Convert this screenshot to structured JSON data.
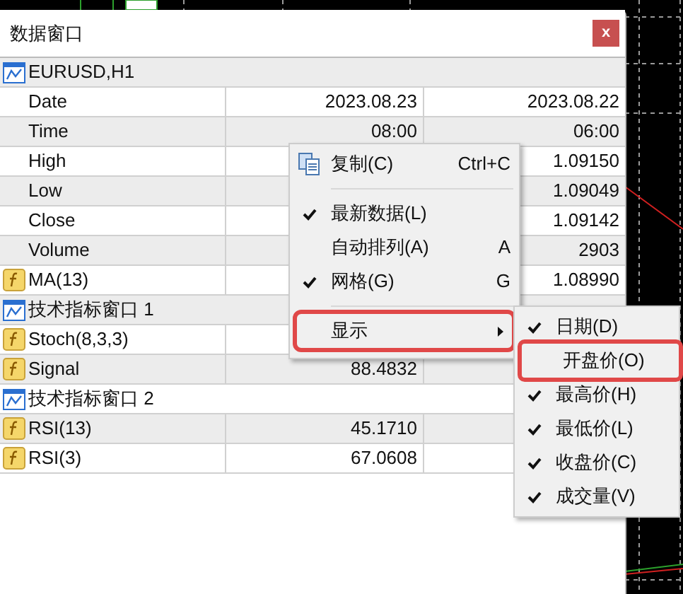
{
  "window": {
    "title": "数据窗口",
    "close": "x"
  },
  "table": {
    "rows": [
      {
        "kind": "group",
        "label": "EURUSD,H1"
      },
      {
        "kind": "field",
        "label": "Date",
        "column_2": "2023.08.23",
        "column_3": "2023.08.22"
      },
      {
        "kind": "field",
        "label": "Time",
        "column_2": "08:00",
        "column_3": "06:00"
      },
      {
        "kind": "field",
        "label": "High",
        "column_3": "1.09150"
      },
      {
        "kind": "field",
        "label": "Low",
        "column_3": "1.09049"
      },
      {
        "kind": "field",
        "label": "Close",
        "column_3": "1.09142"
      },
      {
        "kind": "field",
        "label": "Volume",
        "column_3": "2903"
      },
      {
        "kind": "indicator",
        "label": "MA(13)",
        "column_3": "1.08990"
      },
      {
        "kind": "group",
        "label": "技术指标窗口 1"
      },
      {
        "kind": "indicator",
        "label": "Stoch(8,3,3)"
      },
      {
        "kind": "indicator",
        "label": "Signal",
        "column_2": "88.4832"
      },
      {
        "kind": "group",
        "label": "技术指标窗口 2"
      },
      {
        "kind": "indicator",
        "label": "RSI(13)",
        "column_2": "45.1710"
      },
      {
        "kind": "indicator",
        "label": "RSI(3)",
        "column_2": "67.0608"
      }
    ]
  },
  "context_menu": {
    "items": [
      {
        "kind": "action",
        "label": "复制(C)",
        "shortcut": "Ctrl+C"
      },
      {
        "kind": "separator"
      },
      {
        "kind": "check",
        "label": "最新数据(L)",
        "checked": true
      },
      {
        "kind": "check",
        "label": "自动排列(A)",
        "shortcut": "A",
        "checked": false
      },
      {
        "kind": "check",
        "label": "网格(G)",
        "shortcut": "G",
        "checked": true
      },
      {
        "kind": "separator"
      },
      {
        "kind": "submenu",
        "label": "显示",
        "highlighted": true
      }
    ]
  },
  "submenu": {
    "items": [
      {
        "label": "日期(D)",
        "checked": true,
        "highlighted": false
      },
      {
        "label": "开盘价(O)",
        "checked": false,
        "highlighted": true
      },
      {
        "label": "最高价(H)",
        "checked": true,
        "highlighted": false
      },
      {
        "label": "最低价(L)",
        "checked": true,
        "highlighted": false
      },
      {
        "label": "收盘价(C)",
        "checked": true,
        "highlighted": false
      },
      {
        "label": "成交量(V)",
        "checked": true,
        "highlighted": false
      }
    ]
  }
}
